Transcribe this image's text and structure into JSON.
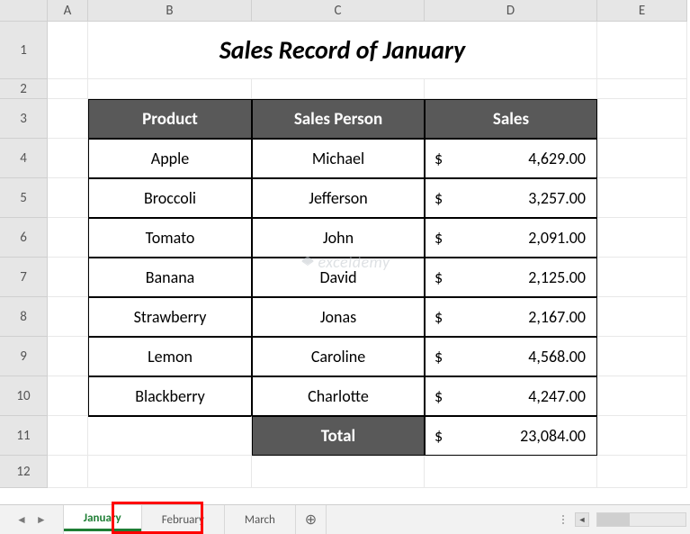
{
  "columns": [
    "A",
    "B",
    "C",
    "D",
    "E"
  ],
  "rows": [
    "1",
    "2",
    "3",
    "4",
    "5",
    "6",
    "7",
    "8",
    "9",
    "10",
    "11",
    "12"
  ],
  "title": "Sales Record of January",
  "table": {
    "headers": {
      "product": "Product",
      "person": "Sales Person",
      "sales": "Sales"
    },
    "rows": [
      {
        "product": "Apple",
        "person": "Michael",
        "sales_display": "4,629.00"
      },
      {
        "product": "Broccoli",
        "person": "Jefferson",
        "sales_display": "3,257.00"
      },
      {
        "product": "Tomato",
        "person": "John",
        "sales_display": "2,091.00"
      },
      {
        "product": "Banana",
        "person": "David",
        "sales_display": "2,125.00"
      },
      {
        "product": "Strawberry",
        "person": "Jonas",
        "sales_display": "2,167.00"
      },
      {
        "product": "Lemon",
        "person": "Caroline",
        "sales_display": "4,568.00"
      },
      {
        "product": "Blackberry",
        "person": "Charlotte",
        "sales_display": "4,247.00"
      }
    ],
    "currency_symbol": "$",
    "total_label": "Total",
    "total_display": "23,084.00"
  },
  "tabs": {
    "items": [
      {
        "label": "January",
        "active": true
      },
      {
        "label": "February",
        "active": false
      },
      {
        "label": "March",
        "active": false
      }
    ],
    "new_tab_glyph": "⊕"
  },
  "nav": {
    "left": "◄",
    "right": "►"
  },
  "watermark": "exceldemy"
}
